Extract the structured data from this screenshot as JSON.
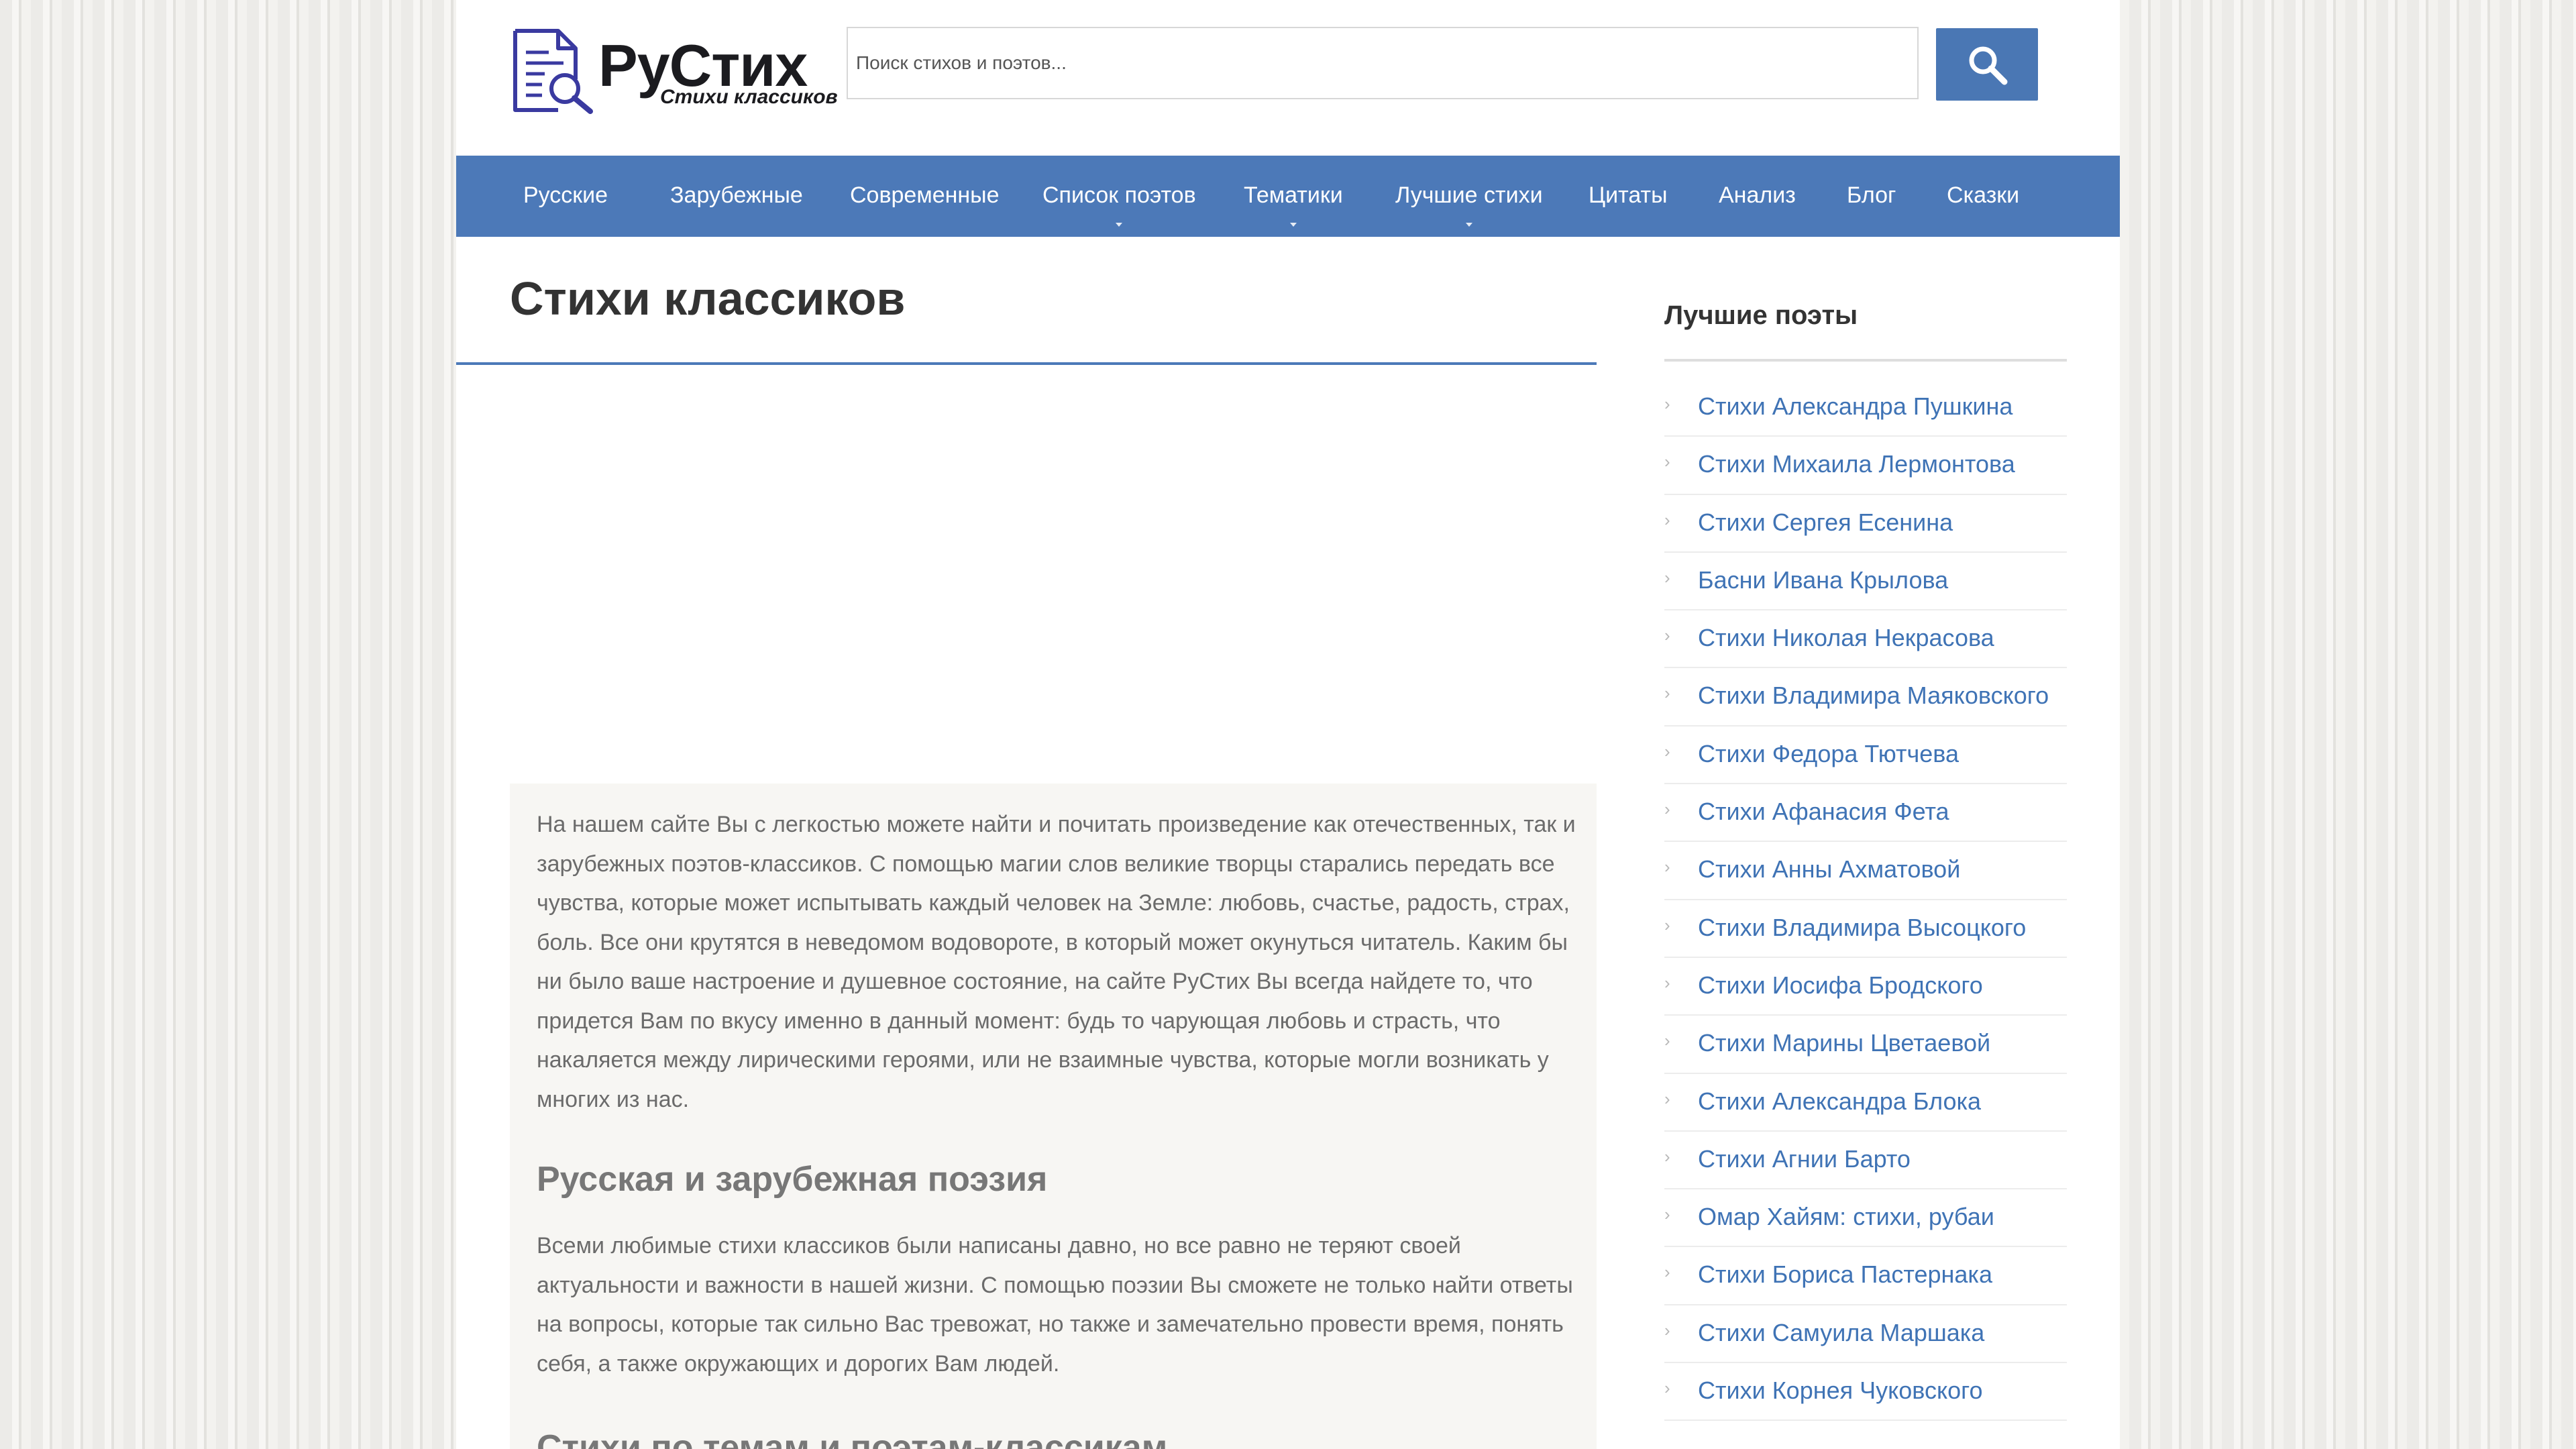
{
  "header": {
    "logo_title": "РуСтих",
    "logo_subtitle": "Стихи классиков",
    "search_placeholder": "Поиск стихов и поэтов...",
    "search_value": ""
  },
  "nav": {
    "items": [
      {
        "label": "Русские",
        "has_dropdown": false
      },
      {
        "label": "Зарубежные",
        "has_dropdown": false
      },
      {
        "label": "Современные",
        "has_dropdown": false
      },
      {
        "label": "Список поэтов",
        "has_dropdown": true
      },
      {
        "label": "Тематики",
        "has_dropdown": true
      },
      {
        "label": "Лучшие стихи",
        "has_dropdown": true
      },
      {
        "label": "Цитаты",
        "has_dropdown": false
      },
      {
        "label": "Анализ",
        "has_dropdown": false
      },
      {
        "label": "Блог",
        "has_dropdown": false
      },
      {
        "label": "Сказки",
        "has_dropdown": false
      }
    ]
  },
  "main": {
    "title": "Стихи классиков",
    "paragraph1": "На нашем сайте Вы с легкостью можете найти и почитать произведение как отечественных, так и зарубежных поэтов-классиков. С помощью магии слов великие творцы старались передать все чувства, которые может испытывать каждый человек на Земле: любовь, счастье, радость, страх, боль. Все они крутятся в неведомом водовороте, в который может окунуться читатель. Каким бы ни было ваше настроение и душевное состояние, на сайте РуСтих Вы всегда найдете то, что придется Вам по вкусу именно в данный момент: будь то чарующая любовь и страсть, что накаляется между лирическими героями, или не взаимные чувства, которые могли возникать у многих из нас.",
    "heading2": "Русская и зарубежная поэзия",
    "paragraph2": "Всеми любимые стихи классиков были написаны давно, но все равно не теряют своей актуальности и важности в нашей жизни. С помощью поэзии Вы сможете не только найти ответы на вопросы, которые так сильно Вас тревожат, но также и замечательно провести время, понять себя, а также окружающих и дорогих Вам людей.",
    "heading3": "Стихи по темам и поэтам-классикам"
  },
  "sidebar": {
    "title": "Лучшие поэты",
    "items": [
      {
        "label": "Стихи Александра Пушкина"
      },
      {
        "label": "Стихи Михаила Лермонтова"
      },
      {
        "label": "Стихи Сергея Есенина"
      },
      {
        "label": "Басни Ивана Крылова"
      },
      {
        "label": "Стихи Николая Некрасова"
      },
      {
        "label": "Стихи Владимира Маяковского"
      },
      {
        "label": "Стихи Федора Тютчева"
      },
      {
        "label": "Стихи Афанасия Фета"
      },
      {
        "label": "Стихи Анны Ахматовой"
      },
      {
        "label": "Стихи Владимира Высоцкого"
      },
      {
        "label": "Стихи Иосифа Бродского"
      },
      {
        "label": "Стихи Марины Цветаевой"
      },
      {
        "label": "Стихи Александра Блока"
      },
      {
        "label": "Стихи Агнии Барто"
      },
      {
        "label": "Омар Хайям: стихи, рубаи"
      },
      {
        "label": "Стихи Бориса Пастернака"
      },
      {
        "label": "Стихи Самуила Маршака"
      },
      {
        "label": "Стихи Корнея Чуковского"
      }
    ]
  },
  "colors": {
    "accent": "#4c79b8",
    "link": "#3f73b5",
    "logo_icon": "#3a3aa0"
  },
  "icons": {
    "logo": "document-magnifier-icon",
    "search": "search-icon",
    "nav_dropdown": "caret-down-icon",
    "sidebar_bullet": "chevron-right-icon"
  }
}
